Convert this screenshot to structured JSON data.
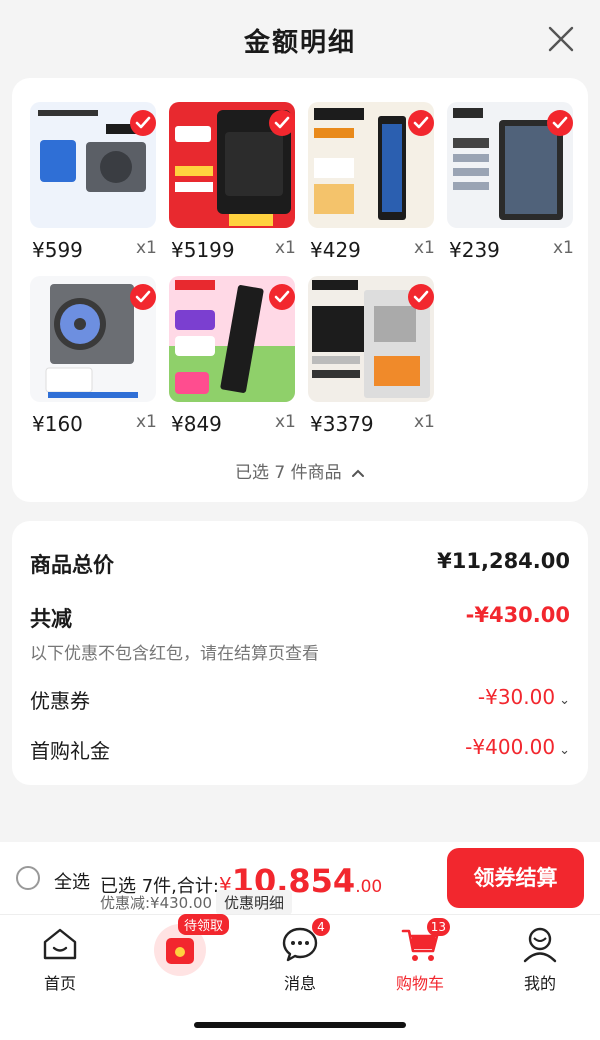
{
  "header": {
    "title": "金额明细"
  },
  "products": [
    {
      "price": "¥599",
      "qty": "x1",
      "bg": "#eef3fb",
      "accent": "#2f6fd6"
    },
    {
      "price": "¥5199",
      "qty": "x1",
      "bg": "#e8292f",
      "accent": "#1c1c1c"
    },
    {
      "price": "¥429",
      "qty": "x1",
      "bg": "#f5f0e6",
      "accent": "#e98a1b"
    },
    {
      "price": "¥239",
      "qty": "x1",
      "bg": "#f1f3f6",
      "accent": "#2b2b2b"
    },
    {
      "price": "¥160",
      "qty": "x1",
      "bg": "#f6f7f9",
      "accent": "#3a3a3a"
    },
    {
      "price": "¥849",
      "qty": "x1",
      "bg": "#ffd9e6",
      "accent": "#1c1c1c"
    },
    {
      "price": "¥3379",
      "qty": "x1",
      "bg": "#f2eee8",
      "accent": "#f08a2a"
    }
  ],
  "selected_toggle": "已选 7 件商品",
  "breakdown": {
    "total_label": "商品总价",
    "total_value": "¥11,284.00",
    "reduce_label": "共减",
    "reduce_value": "-¥430.00",
    "note": "以下优惠不包含红包，请在结算页查看",
    "coupon_label": "优惠券",
    "coupon_value": "-¥30.00",
    "gift_label": "首购礼金",
    "gift_value": "-¥400.00"
  },
  "bottom_bar": {
    "select_all": "全选",
    "summary_prefix": "已选 7件,合计:",
    "currency": "¥",
    "amount_int": "10,854",
    "amount_dec": ".00",
    "discount": "优惠减:¥430.00",
    "detail_tag": "优惠明细",
    "checkout": "领券结算"
  },
  "nav": {
    "home": "首页",
    "pending": "待领取",
    "messages": "消息",
    "messages_badge": "4",
    "cart": "购物车",
    "cart_badge": "13",
    "mine": "我的"
  },
  "colors": {
    "accent": "#f2272e"
  }
}
